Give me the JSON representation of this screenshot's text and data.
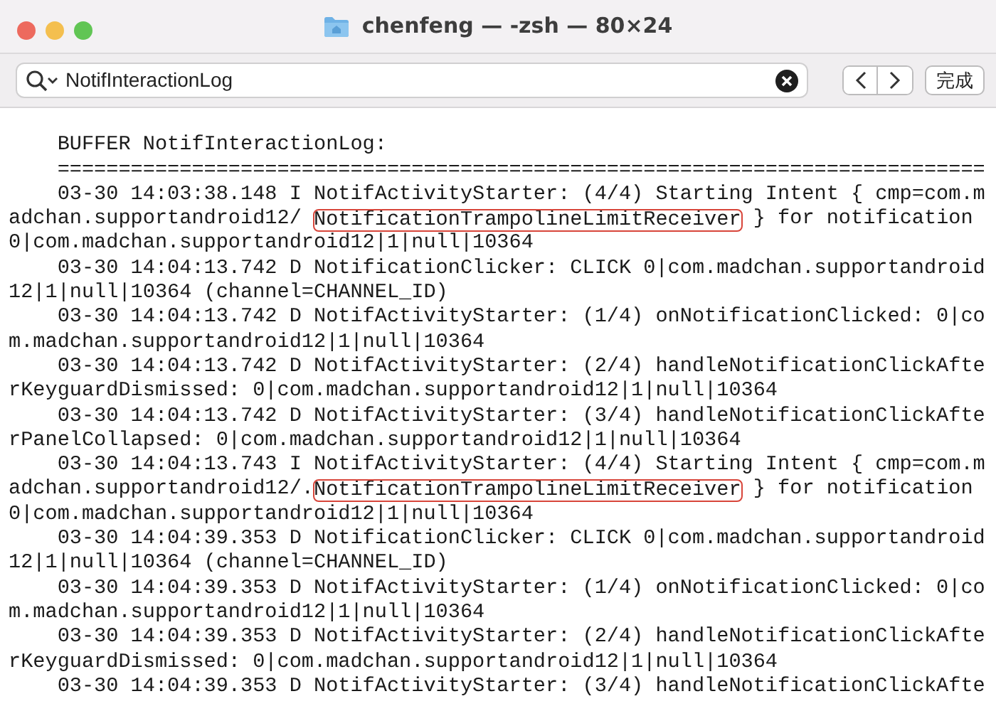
{
  "window": {
    "title": "chenfeng — -zsh — 80×24"
  },
  "find_bar": {
    "value": "NotifInteractionLog",
    "done_button": "完成"
  },
  "terminal": {
    "lines": [
      {
        "kind": "blank"
      },
      {
        "kind": "plain",
        "text": "    BUFFER NotifInteractionLog:"
      },
      {
        "kind": "plain",
        "text": "    ============================================================================"
      },
      {
        "kind": "plain",
        "text": "    03-30 14:03:38.148 I NotifActivityStarter: (4/4) Starting Intent { cmp=com.m"
      },
      {
        "kind": "annotated",
        "before": "adchan.supportandroid12/ ",
        "boxed": "NotificationTrampolineLimitReceiver",
        "after": " } for notification"
      },
      {
        "kind": "plain",
        "text": "0|com.madchan.supportandroid12|1|null|10364"
      },
      {
        "kind": "plain",
        "text": "    03-30 14:04:13.742 D NotificationClicker: CLICK 0|com.madchan.supportandroid"
      },
      {
        "kind": "plain",
        "text": "12|1|null|10364 (channel=CHANNEL_ID)"
      },
      {
        "kind": "plain",
        "text": "    03-30 14:04:13.742 D NotifActivityStarter: (1/4) onNotificationClicked: 0|co"
      },
      {
        "kind": "plain",
        "text": "m.madchan.supportandroid12|1|null|10364"
      },
      {
        "kind": "plain",
        "text": "    03-30 14:04:13.742 D NotifActivityStarter: (2/4) handleNotificationClickAfte"
      },
      {
        "kind": "plain",
        "text": "rKeyguardDismissed: 0|com.madchan.supportandroid12|1|null|10364"
      },
      {
        "kind": "plain",
        "text": "    03-30 14:04:13.742 D NotifActivityStarter: (3/4) handleNotificationClickAfte"
      },
      {
        "kind": "plain",
        "text": "rPanelCollapsed: 0|com.madchan.supportandroid12|1|null|10364"
      },
      {
        "kind": "plain",
        "text": "    03-30 14:04:13.743 I NotifActivityStarter: (4/4) Starting Intent { cmp=com.m"
      },
      {
        "kind": "annotated",
        "before": "adchan.supportandroid12/.",
        "boxed": "NotificationTrampolineLimitReceiver",
        "after": " } for notification"
      },
      {
        "kind": "plain",
        "text": "0|com.madchan.supportandroid12|1|null|10364"
      },
      {
        "kind": "plain",
        "text": "    03-30 14:04:39.353 D NotificationClicker: CLICK 0|com.madchan.supportandroid"
      },
      {
        "kind": "plain",
        "text": "12|1|null|10364 (channel=CHANNEL_ID)"
      },
      {
        "kind": "plain",
        "text": "    03-30 14:04:39.353 D NotifActivityStarter: (1/4) onNotificationClicked: 0|co"
      },
      {
        "kind": "plain",
        "text": "m.madchan.supportandroid12|1|null|10364"
      },
      {
        "kind": "plain",
        "text": "    03-30 14:04:39.353 D NotifActivityStarter: (2/4) handleNotificationClickAfte"
      },
      {
        "kind": "plain",
        "text": "rKeyguardDismissed: 0|com.madchan.supportandroid12|1|null|10364"
      },
      {
        "kind": "plain",
        "text": "    03-30 14:04:39.353 D NotifActivityStarter: (3/4) handleNotificationClickAfte"
      }
    ]
  }
}
